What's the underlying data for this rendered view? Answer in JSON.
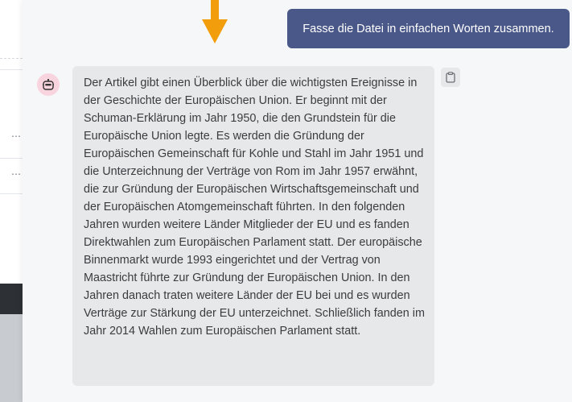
{
  "background": {
    "more_glyph": "⋯"
  },
  "chat": {
    "user_message": "Fasse die Datei in einfachen Worten zusammen.",
    "assistant_message": "Der Artikel gibt einen Überblick über die wichtigsten Ereignisse in der Geschichte der Europäischen Union. Er beginnt mit der Schuman-Erklärung im Jahr 1950, die den Grundstein für die Europäische Union legte. Es werden die Gründung der Europäischen Gemeinschaft für Kohle und Stahl im Jahr 1951 und die Unterzeichnung der Verträge von Rom im Jahr 1957 erwähnt, die zur Gründung der Europäischen Wirtschaftsgemeinschaft und der Europäischen Atomgemeinschaft führten. In den folgenden Jahren wurden weitere Länder Mitglieder der EU und es fanden Direktwahlen zum Europäischen Parlament statt. Der europäische Binnenmarkt wurde 1993 eingerichtet und der Vertrag von Maastricht führte zur Gründung der Europäischen Union. In den Jahren danach traten weitere Länder der EU bei und es wurden Verträge zur Stärkung der EU unterzeichnet. Schließlich fanden im Jahr 2014 Wahlen zum Europäischen Parlament statt."
  },
  "icons": {
    "avatar": "robot-icon",
    "copy": "clipboard-icon",
    "annotation": "arrow-down-icon"
  },
  "colors": {
    "user_bubble": "#4a5889",
    "assistant_bubble": "#e6e8ea",
    "avatar_bg": "#f8d4de",
    "arrow": "#f29d0c"
  }
}
